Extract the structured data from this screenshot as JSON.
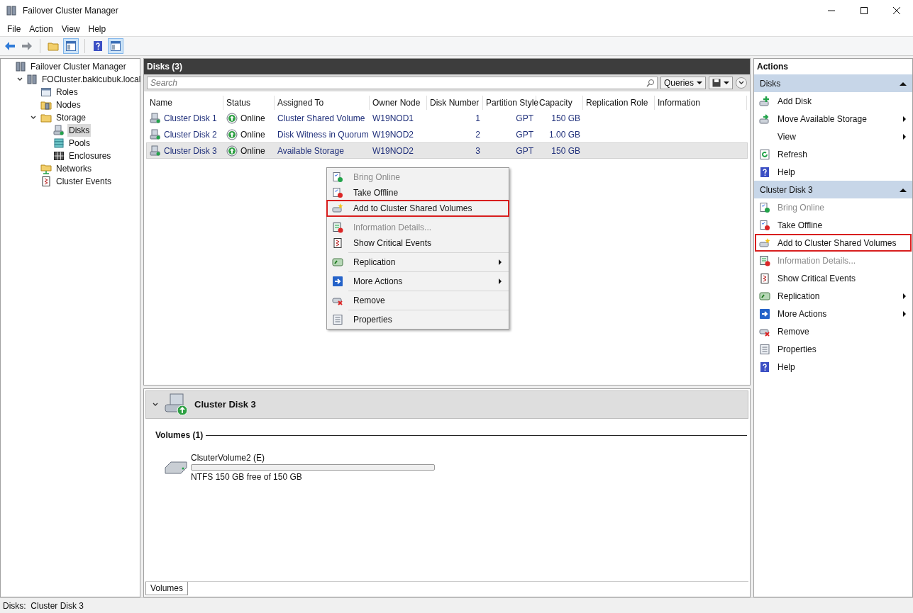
{
  "window": {
    "title": "Failover Cluster Manager"
  },
  "menu_bar": [
    "File",
    "Action",
    "View",
    "Help"
  ],
  "tree": [
    {
      "label": "Failover Cluster Manager",
      "selected": false,
      "children": [
        {
          "label": "FOCluster.bakicubuk.local",
          "selected": false,
          "expanded": true,
          "children": [
            {
              "label": "Roles",
              "selected": false
            },
            {
              "label": "Nodes",
              "selected": false
            },
            {
              "label": "Storage",
              "selected": false,
              "expanded": true,
              "children": [
                {
                  "label": "Disks",
                  "selected": true
                },
                {
                  "label": "Pools",
                  "selected": false
                },
                {
                  "label": "Enclosures",
                  "selected": false
                }
              ]
            },
            {
              "label": "Networks",
              "selected": false
            },
            {
              "label": "Cluster Events",
              "selected": false
            }
          ]
        }
      ]
    }
  ],
  "panel": {
    "title": "Disks (3)",
    "search": {
      "placeholder": "Search"
    },
    "queries_button": "Queries",
    "columns": [
      "Name",
      "Status",
      "Assigned To",
      "Owner Node",
      "Disk Number",
      "Partition Style",
      "Capacity",
      "Replication Role",
      "Information"
    ],
    "rows": [
      {
        "name": "Cluster Disk 1",
        "status": "Online",
        "assigned_to": "Cluster Shared Volume",
        "owner_node": "W19NOD1",
        "disk_number": "1",
        "partition_style": "GPT",
        "capacity": "150 GB",
        "selected": false
      },
      {
        "name": "Cluster Disk 2",
        "status": "Online",
        "assigned_to": "Disk Witness in Quorum",
        "owner_node": "W19NOD2",
        "disk_number": "2",
        "partition_style": "GPT",
        "capacity": "1.00 GB",
        "selected": false
      },
      {
        "name": "Cluster Disk 3",
        "status": "Online",
        "assigned_to": "Available Storage",
        "owner_node": "W19NOD2",
        "disk_number": "3",
        "partition_style": "GPT",
        "capacity": "150 GB",
        "selected": true
      }
    ]
  },
  "context_menu": {
    "groups": [
      [
        {
          "label": "Bring Online",
          "disabled": true,
          "highlighted": false,
          "submenu": false
        },
        {
          "label": "Take Offline",
          "disabled": false,
          "highlighted": false,
          "submenu": false
        },
        {
          "label": "Add to Cluster Shared Volumes",
          "disabled": false,
          "highlighted": true,
          "submenu": false
        }
      ],
      [
        {
          "label": "Information Details...",
          "disabled": true,
          "highlighted": false,
          "submenu": false
        },
        {
          "label": "Show Critical Events",
          "disabled": false,
          "highlighted": false,
          "submenu": false
        }
      ],
      [
        {
          "label": "Replication",
          "disabled": false,
          "highlighted": false,
          "submenu": true
        }
      ],
      [
        {
          "label": "More Actions",
          "disabled": false,
          "highlighted": false,
          "submenu": true
        }
      ],
      [
        {
          "label": "Remove",
          "disabled": false,
          "highlighted": false,
          "submenu": false
        }
      ],
      [
        {
          "label": "Properties",
          "disabled": false,
          "highlighted": false,
          "submenu": false
        }
      ]
    ]
  },
  "details": {
    "title": "Cluster Disk 3",
    "section": "Volumes (1)",
    "volume": {
      "name": "ClsuterVolume2 (E)",
      "level": 0,
      "info": "NTFS 150 GB free of 150 GB"
    },
    "tabs": [
      {
        "label": "Volumes",
        "selected": true
      }
    ]
  },
  "actions": {
    "title": "Actions",
    "sections": [
      {
        "title": "Disks",
        "expanded": true,
        "items": [
          {
            "label": "Add Disk",
            "disabled": false,
            "highlighted": false,
            "submenu": false
          },
          {
            "label": "Move Available Storage",
            "disabled": false,
            "highlighted": false,
            "submenu": true
          },
          {
            "label": "View",
            "disabled": false,
            "highlighted": false,
            "submenu": true
          },
          {
            "label": "Refresh",
            "disabled": false,
            "highlighted": false,
            "submenu": false
          },
          {
            "label": "Help",
            "disabled": false,
            "highlighted": false,
            "submenu": false
          }
        ]
      },
      {
        "title": "Cluster Disk 3",
        "expanded": true,
        "items": [
          {
            "label": "Bring Online",
            "disabled": true,
            "highlighted": false,
            "submenu": false
          },
          {
            "label": "Take Offline",
            "disabled": false,
            "highlighted": false,
            "submenu": false
          },
          {
            "label": "Add to Cluster Shared Volumes",
            "disabled": false,
            "highlighted": true,
            "submenu": false
          },
          {
            "label": "Information Details...",
            "disabled": true,
            "highlighted": false,
            "submenu": false
          },
          {
            "label": "Show Critical Events",
            "disabled": false,
            "highlighted": false,
            "submenu": false
          },
          {
            "label": "Replication",
            "disabled": false,
            "highlighted": false,
            "submenu": true
          },
          {
            "label": "More Actions",
            "disabled": false,
            "highlighted": false,
            "submenu": true
          },
          {
            "label": "Remove",
            "disabled": false,
            "highlighted": false,
            "submenu": false
          },
          {
            "label": "Properties",
            "disabled": false,
            "highlighted": false,
            "submenu": false
          },
          {
            "label": "Help",
            "disabled": false,
            "highlighted": false,
            "submenu": false
          }
        ]
      }
    ]
  },
  "status_bar": "Disks:  Cluster Disk 3"
}
